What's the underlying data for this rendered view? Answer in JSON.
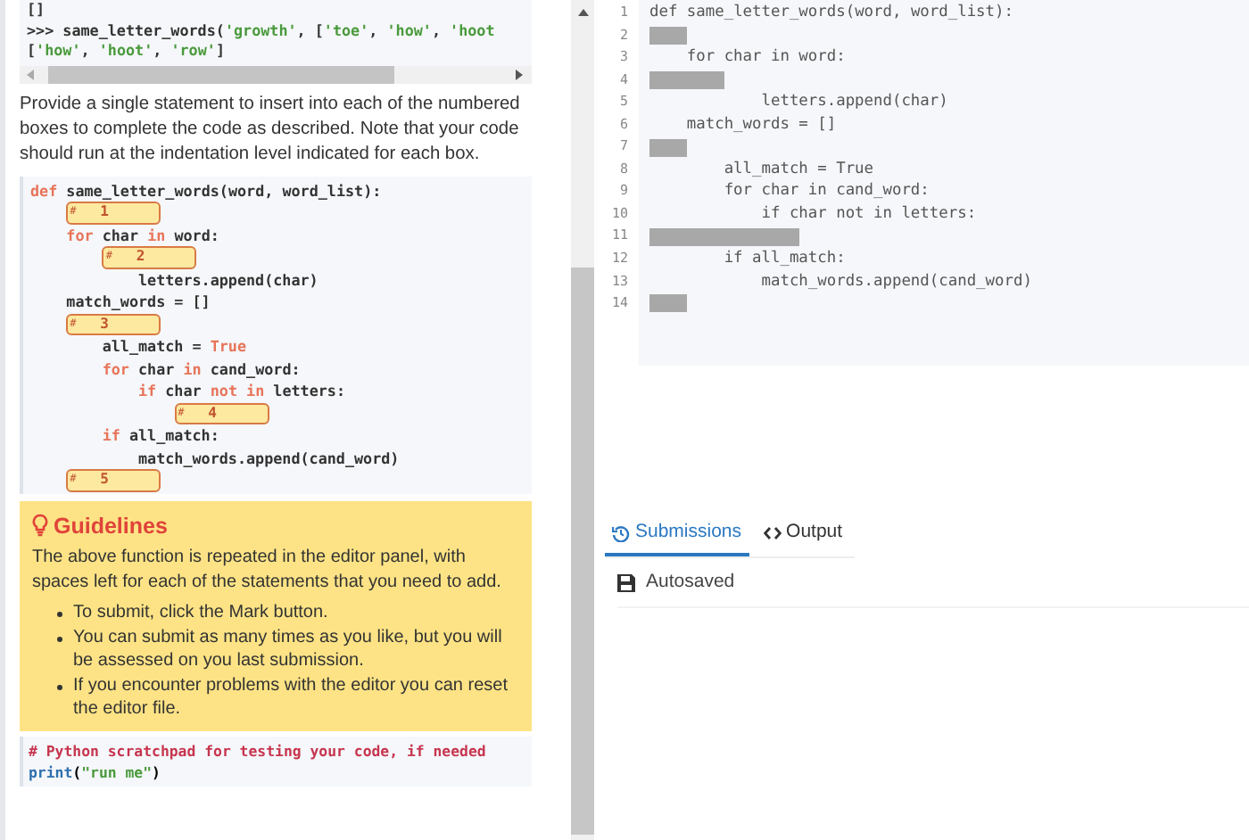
{
  "example": {
    "lines": [
      [
        {
          "text": "[]",
          "kind": "plain"
        }
      ],
      [
        {
          "text": ">>> same_letter_words(",
          "kind": "plain"
        },
        {
          "text": "'growth'",
          "kind": "string"
        },
        {
          "text": ", [",
          "kind": "plain"
        },
        {
          "text": "'toe'",
          "kind": "string"
        },
        {
          "text": ", ",
          "kind": "plain"
        },
        {
          "text": "'how'",
          "kind": "string"
        },
        {
          "text": ", ",
          "kind": "plain"
        },
        {
          "text": "'hoot",
          "kind": "string"
        }
      ],
      [
        {
          "text": "[",
          "kind": "plain"
        },
        {
          "text": "'how'",
          "kind": "string"
        },
        {
          "text": ", ",
          "kind": "plain"
        },
        {
          "text": "'hoot'",
          "kind": "string"
        },
        {
          "text": ", ",
          "kind": "plain"
        },
        {
          "text": "'row'",
          "kind": "string"
        },
        {
          "text": "]",
          "kind": "plain"
        }
      ]
    ]
  },
  "instructions": "Provide a single statement to insert into each of the numbered boxes to complete the code as described. Note that your code should run at the indentation level indicated for each box.",
  "template": [
    {
      "kind": "code",
      "tokens": [
        {
          "text": "def",
          "kind": "keyword"
        },
        {
          "text": " same_letter_words(word, word_list):",
          "kind": "plain"
        }
      ],
      "children": [
        {
          "kind": "blank",
          "mark": "#",
          "number": "1"
        },
        {
          "kind": "code",
          "tokens": [
            {
              "text": "for",
              "kind": "keyword"
            },
            {
              "text": " char ",
              "kind": "plain"
            },
            {
              "text": "in",
              "kind": "keyword"
            },
            {
              "text": " word:",
              "kind": "plain"
            }
          ],
          "children": [
            {
              "kind": "blank",
              "mark": "#",
              "number": "2",
              "children": [
                {
                  "kind": "code",
                  "tokens": [
                    {
                      "text": "letters.append(char)",
                      "kind": "plain"
                    }
                  ]
                }
              ]
            }
          ]
        },
        {
          "kind": "code",
          "tokens": [
            {
              "text": "match_words = []",
              "kind": "plain"
            }
          ]
        },
        {
          "kind": "blank",
          "mark": "#",
          "number": "3",
          "children": [
            {
              "kind": "code",
              "tokens": [
                {
                  "text": "all_match = ",
                  "kind": "plain"
                },
                {
                  "text": "True",
                  "kind": "keyword"
                }
              ]
            },
            {
              "kind": "code",
              "tokens": [
                {
                  "text": "for",
                  "kind": "keyword"
                },
                {
                  "text": " char ",
                  "kind": "plain"
                },
                {
                  "text": "in",
                  "kind": "keyword"
                },
                {
                  "text": " cand_word:",
                  "kind": "plain"
                }
              ],
              "children": [
                {
                  "kind": "code",
                  "tokens": [
                    {
                      "text": "if",
                      "kind": "keyword"
                    },
                    {
                      "text": " char ",
                      "kind": "plain"
                    },
                    {
                      "text": "not in",
                      "kind": "keyword"
                    },
                    {
                      "text": " letters:",
                      "kind": "plain"
                    }
                  ],
                  "children": [
                    {
                      "kind": "blank",
                      "mark": "#",
                      "number": "4"
                    }
                  ]
                }
              ]
            },
            {
              "kind": "code",
              "tokens": [
                {
                  "text": "if",
                  "kind": "keyword"
                },
                {
                  "text": " all_match:",
                  "kind": "plain"
                }
              ],
              "children": [
                {
                  "kind": "code",
                  "tokens": [
                    {
                      "text": "match_words.append(cand_word)",
                      "kind": "plain"
                    }
                  ]
                }
              ]
            }
          ]
        },
        {
          "kind": "blank",
          "mark": "#",
          "number": "5"
        }
      ]
    }
  ],
  "guidelines": {
    "title": "Guidelines",
    "intro": "The above function is repeated in the editor panel, with spaces left for each of the statements that you need to add.",
    "bullets": [
      "To submit, click the Mark button.",
      "You can submit as many times as you like, but you will be assessed on you last submission.",
      "If you encounter problems with the editor you can reset the editor file."
    ]
  },
  "scratchpad": {
    "lines": [
      [
        {
          "text": "# Python scratchpad for testing your code, if needed",
          "kind": "comment"
        }
      ],
      [
        {
          "text": "print",
          "kind": "builtin"
        },
        {
          "text": "(",
          "kind": "plain"
        },
        {
          "text": "\"run me\"",
          "kind": "string"
        },
        {
          "text": ")",
          "kind": "plain"
        }
      ]
    ]
  },
  "editor": {
    "lines": [
      {
        "number": "1",
        "kind": "code",
        "text": "def same_letter_words(word, word_list):",
        "children": [
          {
            "number": "2",
            "kind": "blank"
          },
          {
            "number": "3",
            "kind": "code",
            "text": "for char in word:",
            "children": [
              {
                "number": "4",
                "kind": "blank",
                "children": [
                  {
                    "number": "5",
                    "kind": "code",
                    "text": "letters.append(char)"
                  }
                ]
              }
            ]
          },
          {
            "number": "6",
            "kind": "code",
            "text": "match_words = []"
          },
          {
            "number": "7",
            "kind": "blank",
            "children": [
              {
                "number": "8",
                "kind": "code",
                "text": "all_match = True"
              },
              {
                "number": "9",
                "kind": "code",
                "text": "for char in cand_word:",
                "children": [
                  {
                    "number": "10",
                    "kind": "code",
                    "text": "if char not in letters:",
                    "children": [
                      {
                        "number": "11",
                        "kind": "blank"
                      }
                    ]
                  }
                ]
              },
              {
                "number": "12",
                "kind": "code",
                "text": "if all_match:",
                "children": [
                  {
                    "number": "13",
                    "kind": "code",
                    "text": "match_words.append(cand_word)"
                  }
                ]
              }
            ]
          },
          {
            "number": "14",
            "kind": "blank"
          }
        ]
      }
    ]
  },
  "tabs": [
    {
      "label": "Submissions",
      "kind": "history",
      "selected": true
    },
    {
      "label": "Output",
      "kind": "code",
      "selected": false
    }
  ],
  "status": "Autosaved"
}
